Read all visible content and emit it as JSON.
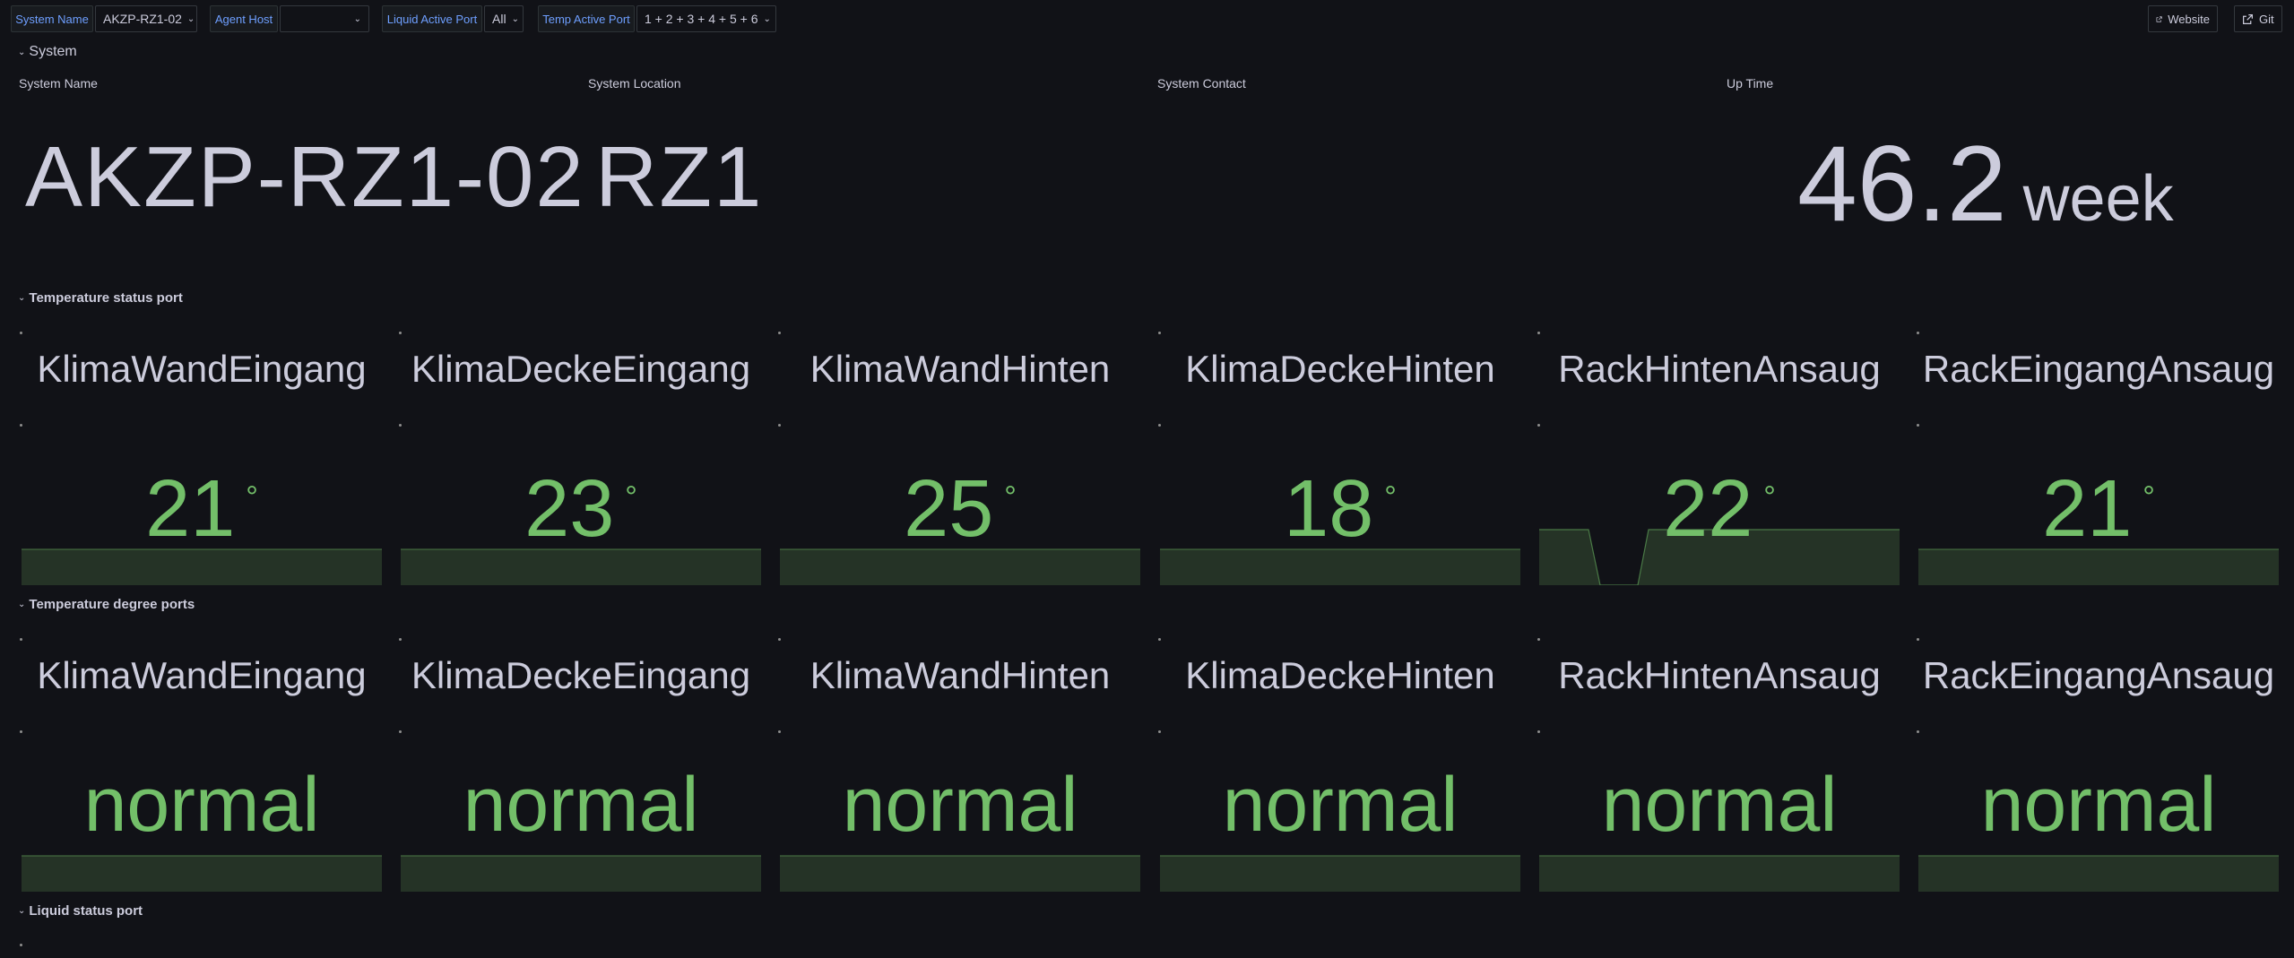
{
  "variables": {
    "system_name_label": "System Name",
    "system_name_value": "AKZP-RZ1-02",
    "agent_host_label": "Agent Host",
    "agent_host_value": "",
    "liquid_port_label": "Liquid Active Port",
    "liquid_port_value": "All",
    "temp_port_label": "Temp Active Port",
    "temp_port_value": "1 + 2 + 3 + 4 + 5 + 6"
  },
  "links": {
    "website": "Website",
    "git": "Git"
  },
  "rows": {
    "system": "System",
    "temp_status": "Temperature status port",
    "temp_degree": "Temperature degree ports",
    "liquid_status": "Liquid status port"
  },
  "system": {
    "name_title": "System Name",
    "name_value": "AKZP-RZ1-02",
    "location_title": "System Location",
    "location_value": "RZ1",
    "contact_title": "System Contact",
    "contact_value": "",
    "uptime_title": "Up Time",
    "uptime_value": "46.2",
    "uptime_unit": "week"
  },
  "temp_status_panels": [
    {
      "label": "KlimaWandEingang",
      "value": "21",
      "unit": "°"
    },
    {
      "label": "KlimaDeckeEingang",
      "value": "23",
      "unit": "°"
    },
    {
      "label": "KlimaWandHinten",
      "value": "25",
      "unit": "°"
    },
    {
      "label": "KlimaDeckeHinten",
      "value": "18",
      "unit": "°"
    },
    {
      "label": "RackHintenAnsaug",
      "value": "22",
      "unit": "°"
    },
    {
      "label": "RackEingangAnsaug",
      "value": "21",
      "unit": "°"
    }
  ],
  "temp_degree_panels": [
    {
      "label": "KlimaWandEingang",
      "value": "normal"
    },
    {
      "label": "KlimaDeckeEingang",
      "value": "normal"
    },
    {
      "label": "KlimaWandHinten",
      "value": "normal"
    },
    {
      "label": "KlimaDeckeHinten",
      "value": "normal"
    },
    {
      "label": "RackHintenAnsaug",
      "value": "normal"
    },
    {
      "label": "RackEingangAnsaug",
      "value": "normal"
    }
  ],
  "colors": {
    "background": "#111217",
    "text": "#ccccdc",
    "accent_link": "#6e9fff",
    "value_green": "#73bf69",
    "spark_fill": "#253326",
    "spark_line": "#4a7a46"
  },
  "icons": {
    "external_link": "external-link-icon",
    "chevron": "chevron-down-icon"
  }
}
